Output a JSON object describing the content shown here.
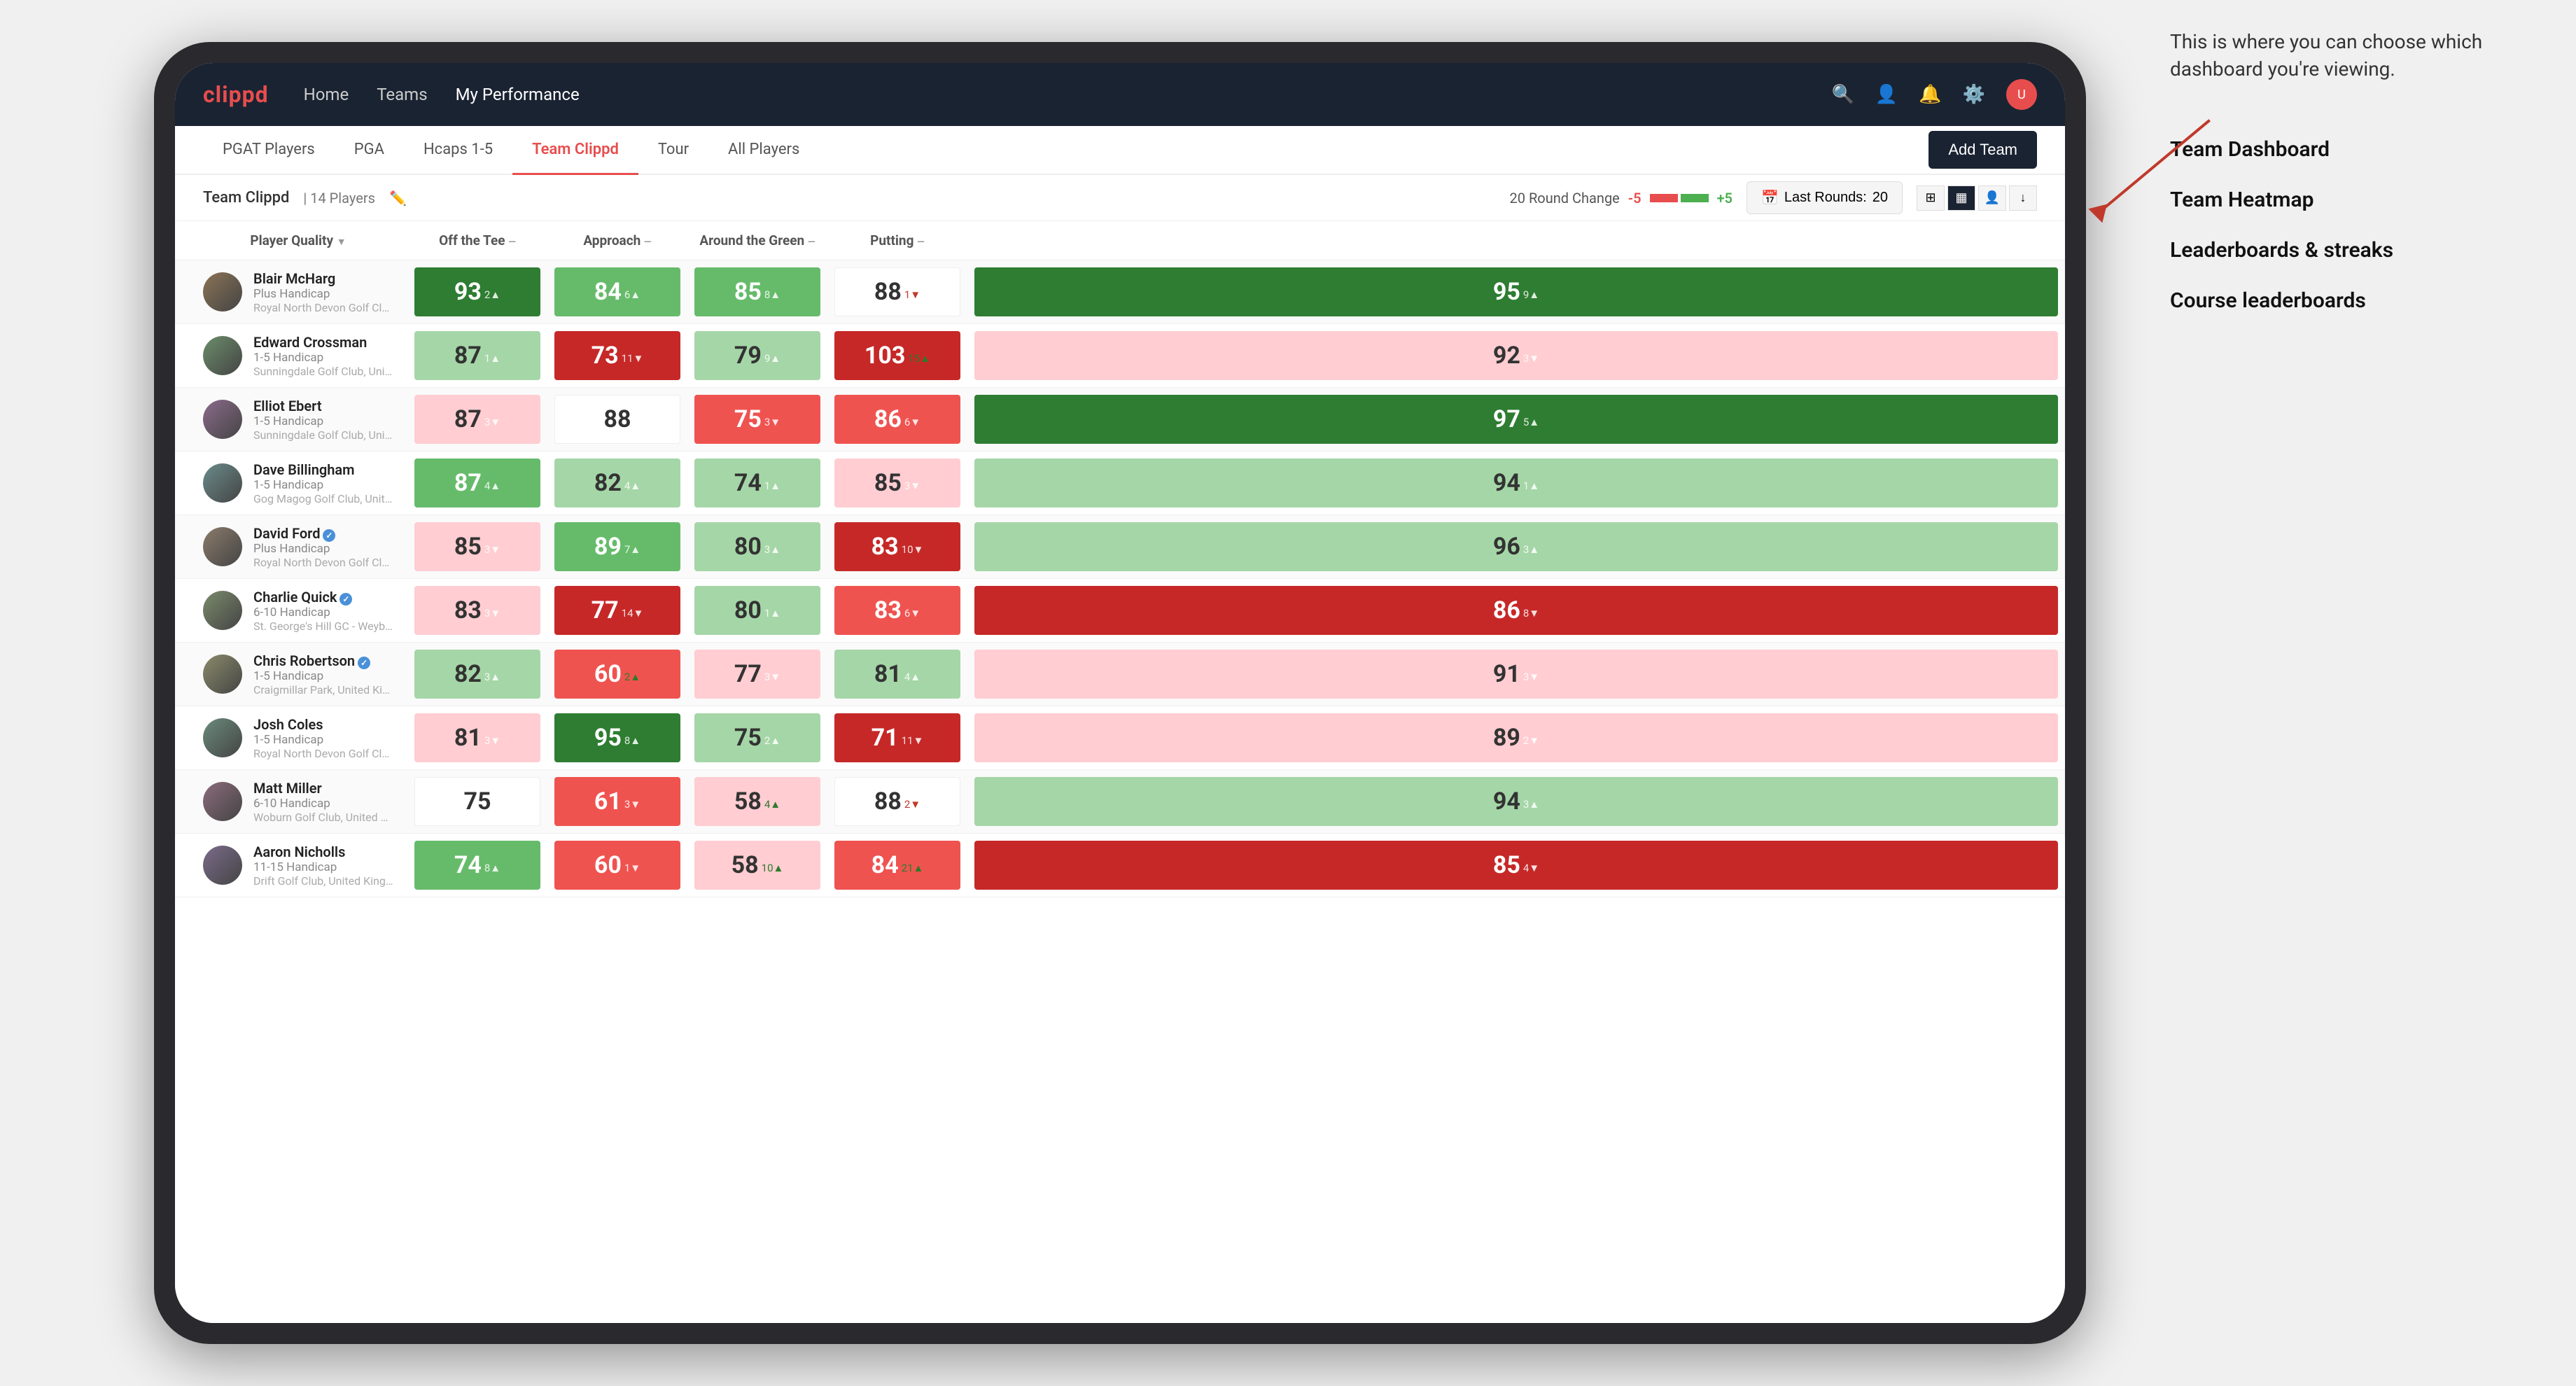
{
  "annotation": {
    "intro": "This is where you can choose which dashboard you're viewing.",
    "items": [
      "Team Dashboard",
      "Team Heatmap",
      "Leaderboards & streaks",
      "Course leaderboards"
    ]
  },
  "nav": {
    "logo": "clippd",
    "items": [
      "Home",
      "Teams",
      "My Performance"
    ],
    "active": "My Performance",
    "icons": [
      "search",
      "person",
      "bell",
      "settings",
      "avatar"
    ]
  },
  "tabs": {
    "items": [
      "PGAT Players",
      "PGA",
      "Hcaps 1-5",
      "Team Clippd",
      "Tour",
      "All Players"
    ],
    "active": "Team Clippd",
    "add_button": "Add Team"
  },
  "subheader": {
    "team_name": "Team Clippd",
    "separator": "|",
    "player_count": "14 Players",
    "round_change_label": "20 Round Change",
    "change_low": "-5",
    "change_high": "+5",
    "last_rounds_label": "Last Rounds:",
    "last_rounds_value": "20"
  },
  "table": {
    "columns": [
      {
        "key": "player",
        "label": "Player Quality"
      },
      {
        "key": "tee",
        "label": "Off the Tee"
      },
      {
        "key": "approach",
        "label": "Approach"
      },
      {
        "key": "around",
        "label": "Around the Green"
      },
      {
        "key": "putting",
        "label": "Putting"
      }
    ],
    "rows": [
      {
        "name": "Blair McHarg",
        "handicap": "Plus Handicap",
        "club": "Royal North Devon Golf Club, United Kingdom",
        "player_quality": {
          "value": "93",
          "change": "2▲",
          "direction": "up",
          "bg": "bg-green-dark"
        },
        "tee": {
          "value": "84",
          "change": "6▲",
          "direction": "up",
          "bg": "bg-green-mid"
        },
        "approach": {
          "value": "85",
          "change": "8▲",
          "direction": "up",
          "bg": "bg-green-mid"
        },
        "around": {
          "value": "88",
          "change": "1▼",
          "direction": "down",
          "bg": "bg-white"
        },
        "putting": {
          "value": "95",
          "change": "9▲",
          "direction": "up",
          "bg": "bg-green-dark"
        }
      },
      {
        "name": "Edward Crossman",
        "handicap": "1-5 Handicap",
        "club": "Sunningdale Golf Club, United Kingdom",
        "player_quality": {
          "value": "87",
          "change": "1▲",
          "direction": "up",
          "bg": "bg-green-light"
        },
        "tee": {
          "value": "73",
          "change": "11▼",
          "direction": "down",
          "bg": "bg-red-dark"
        },
        "approach": {
          "value": "79",
          "change": "9▲",
          "direction": "up",
          "bg": "bg-green-light"
        },
        "around": {
          "value": "103",
          "change": "15▲",
          "direction": "up",
          "bg": "bg-red-dark"
        },
        "putting": {
          "value": "92",
          "change": "3▼",
          "direction": "down",
          "bg": "bg-red-light"
        }
      },
      {
        "name": "Elliot Ebert",
        "handicap": "1-5 Handicap",
        "club": "Sunningdale Golf Club, United Kingdom",
        "player_quality": {
          "value": "87",
          "change": "3▼",
          "direction": "down",
          "bg": "bg-red-light"
        },
        "tee": {
          "value": "88",
          "change": "",
          "direction": "none",
          "bg": "bg-white"
        },
        "approach": {
          "value": "75",
          "change": "3▼",
          "direction": "down",
          "bg": "bg-red-mid"
        },
        "around": {
          "value": "86",
          "change": "6▼",
          "direction": "down",
          "bg": "bg-red-mid"
        },
        "putting": {
          "value": "97",
          "change": "5▲",
          "direction": "up",
          "bg": "bg-green-dark"
        }
      },
      {
        "name": "Dave Billingham",
        "handicap": "1-5 Handicap",
        "club": "Gog Magog Golf Club, United Kingdom",
        "player_quality": {
          "value": "87",
          "change": "4▲",
          "direction": "up",
          "bg": "bg-green-mid"
        },
        "tee": {
          "value": "82",
          "change": "4▲",
          "direction": "up",
          "bg": "bg-green-light"
        },
        "approach": {
          "value": "74",
          "change": "1▲",
          "direction": "up",
          "bg": "bg-green-light"
        },
        "around": {
          "value": "85",
          "change": "3▼",
          "direction": "down",
          "bg": "bg-red-light"
        },
        "putting": {
          "value": "94",
          "change": "1▲",
          "direction": "up",
          "bg": "bg-green-light"
        }
      },
      {
        "name": "David Ford",
        "handicap": "Plus Handicap",
        "club": "Royal North Devon Golf Club, United Kingdom",
        "verified": true,
        "player_quality": {
          "value": "85",
          "change": "3▼",
          "direction": "down",
          "bg": "bg-red-light"
        },
        "tee": {
          "value": "89",
          "change": "7▲",
          "direction": "up",
          "bg": "bg-green-mid"
        },
        "approach": {
          "value": "80",
          "change": "3▲",
          "direction": "up",
          "bg": "bg-green-light"
        },
        "around": {
          "value": "83",
          "change": "10▼",
          "direction": "down",
          "bg": "bg-red-dark"
        },
        "putting": {
          "value": "96",
          "change": "3▲",
          "direction": "up",
          "bg": "bg-green-light"
        }
      },
      {
        "name": "Charlie Quick",
        "handicap": "6-10 Handicap",
        "club": "St. George's Hill GC - Weybridge - Surrey, Uni...",
        "verified": true,
        "player_quality": {
          "value": "83",
          "change": "3▼",
          "direction": "down",
          "bg": "bg-red-light"
        },
        "tee": {
          "value": "77",
          "change": "14▼",
          "direction": "down",
          "bg": "bg-red-dark"
        },
        "approach": {
          "value": "80",
          "change": "1▲",
          "direction": "up",
          "bg": "bg-green-light"
        },
        "around": {
          "value": "83",
          "change": "6▼",
          "direction": "down",
          "bg": "bg-red-mid"
        },
        "putting": {
          "value": "86",
          "change": "8▼",
          "direction": "down",
          "bg": "bg-red-dark"
        }
      },
      {
        "name": "Chris Robertson",
        "handicap": "1-5 Handicap",
        "club": "Craigmillar Park, United Kingdom",
        "verified": true,
        "player_quality": {
          "value": "82",
          "change": "3▲",
          "direction": "up",
          "bg": "bg-green-light"
        },
        "tee": {
          "value": "60",
          "change": "2▲",
          "direction": "up",
          "bg": "bg-red-mid"
        },
        "approach": {
          "value": "77",
          "change": "3▼",
          "direction": "down",
          "bg": "bg-red-light"
        },
        "around": {
          "value": "81",
          "change": "4▲",
          "direction": "up",
          "bg": "bg-green-light"
        },
        "putting": {
          "value": "91",
          "change": "3▼",
          "direction": "down",
          "bg": "bg-red-light"
        }
      },
      {
        "name": "Josh Coles",
        "handicap": "1-5 Handicap",
        "club": "Royal North Devon Golf Club, United Kingdom",
        "player_quality": {
          "value": "81",
          "change": "3▼",
          "direction": "down",
          "bg": "bg-red-light"
        },
        "tee": {
          "value": "95",
          "change": "8▲",
          "direction": "up",
          "bg": "bg-green-dark"
        },
        "approach": {
          "value": "75",
          "change": "2▲",
          "direction": "up",
          "bg": "bg-green-light"
        },
        "around": {
          "value": "71",
          "change": "11▼",
          "direction": "down",
          "bg": "bg-red-dark"
        },
        "putting": {
          "value": "89",
          "change": "2▼",
          "direction": "down",
          "bg": "bg-red-light"
        }
      },
      {
        "name": "Matt Miller",
        "handicap": "6-10 Handicap",
        "club": "Woburn Golf Club, United Kingdom",
        "player_quality": {
          "value": "75",
          "change": "",
          "direction": "none",
          "bg": "bg-white"
        },
        "tee": {
          "value": "61",
          "change": "3▼",
          "direction": "down",
          "bg": "bg-red-mid"
        },
        "approach": {
          "value": "58",
          "change": "4▲",
          "direction": "up",
          "bg": "bg-red-light"
        },
        "around": {
          "value": "88",
          "change": "2▼",
          "direction": "down",
          "bg": "bg-white"
        },
        "putting": {
          "value": "94",
          "change": "3▲",
          "direction": "up",
          "bg": "bg-green-light"
        }
      },
      {
        "name": "Aaron Nicholls",
        "handicap": "11-15 Handicap",
        "club": "Drift Golf Club, United Kingdom",
        "player_quality": {
          "value": "74",
          "change": "8▲",
          "direction": "up",
          "bg": "bg-green-mid"
        },
        "tee": {
          "value": "60",
          "change": "1▼",
          "direction": "down",
          "bg": "bg-red-mid"
        },
        "approach": {
          "value": "58",
          "change": "10▲",
          "direction": "up",
          "bg": "bg-red-light"
        },
        "around": {
          "value": "84",
          "change": "21▲",
          "direction": "up",
          "bg": "bg-red-mid"
        },
        "putting": {
          "value": "85",
          "change": "4▼",
          "direction": "down",
          "bg": "bg-red-dark"
        }
      }
    ]
  }
}
